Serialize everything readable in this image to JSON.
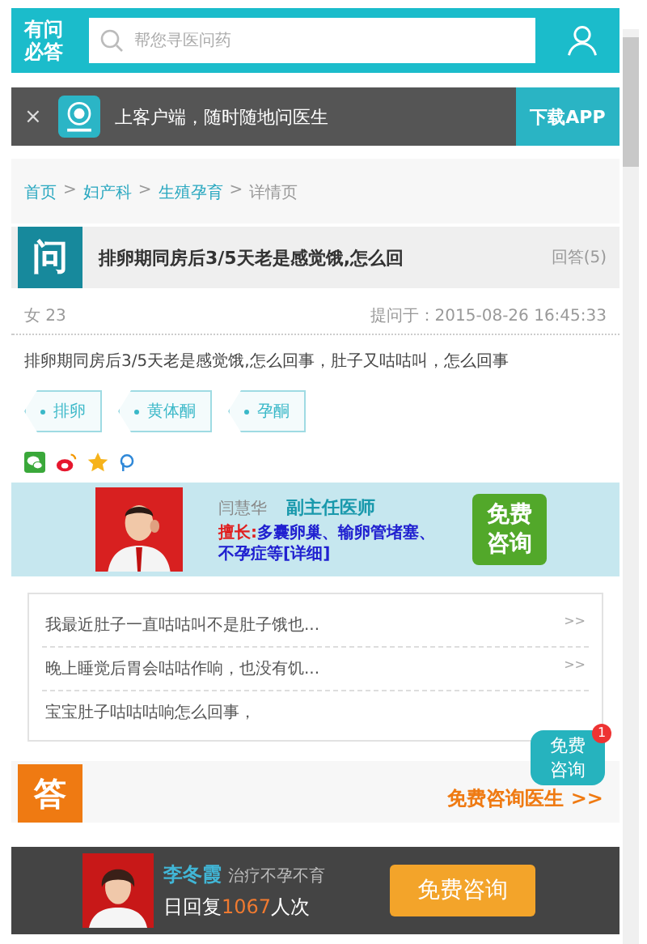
{
  "header": {
    "logo": "有问必答",
    "search": {
      "placeholder": "帮您寻医问药"
    }
  },
  "app_banner": {
    "close": "×",
    "text": "上客户端，随时随地问医生",
    "button": "下载APP"
  },
  "breadcrumb": [
    {
      "label": "首页",
      "link": true
    },
    {
      "label": ">",
      "link": false
    },
    {
      "label": "妇产科",
      "link": true
    },
    {
      "label": ">",
      "link": false
    },
    {
      "label": "生殖孕育",
      "link": true
    },
    {
      "label": ">",
      "link": false
    },
    {
      "label": "详情页",
      "link": false
    }
  ],
  "question": {
    "badge": "问",
    "title": "排卵期同房后3/5天老是感觉饿,怎么回",
    "answers": "回答(5)",
    "asker": "女 23",
    "asked_at": "提问于：2015-08-26 16:45:33",
    "body": "排卵期同房后3/5天老是感觉饿,怎么回事，肚子又咕咕叫，怎么回事",
    "tags": [
      "排卵",
      "黄体酮",
      "孕酮"
    ]
  },
  "share": [
    {
      "kind": "wechat"
    },
    {
      "kind": "weibo"
    },
    {
      "kind": "star"
    },
    {
      "kind": "p"
    }
  ],
  "doctor_card": {
    "name": "闫慧华",
    "title": "副主任医师",
    "specialty_label": "擅长:",
    "specialty": "多囊卵巢、输卵管堵塞、不孕症等[详细]",
    "button": "免费咨询"
  },
  "related": [
    {
      "text": "我最近肚子一直咕咕叫不是肚子饿也...",
      "arrow": ">>"
    },
    {
      "text": "晚上睡觉后胃会咕咕作响，也没有饥...",
      "arrow": ">>"
    },
    {
      "text": "宝宝肚子咕咕咕响怎么回事，"
    }
  ],
  "float_bubble": {
    "text": "免费咨询",
    "badge": "1"
  },
  "answer": {
    "badge": "答",
    "link": "免费咨询医生 >>"
  },
  "bottom_bar": {
    "name": "李冬霞",
    "specialty": "治疗不孕不育",
    "replies_before": "日回复",
    "replies_count": "1067",
    "replies_after": "人次",
    "button": "免费咨询"
  }
}
